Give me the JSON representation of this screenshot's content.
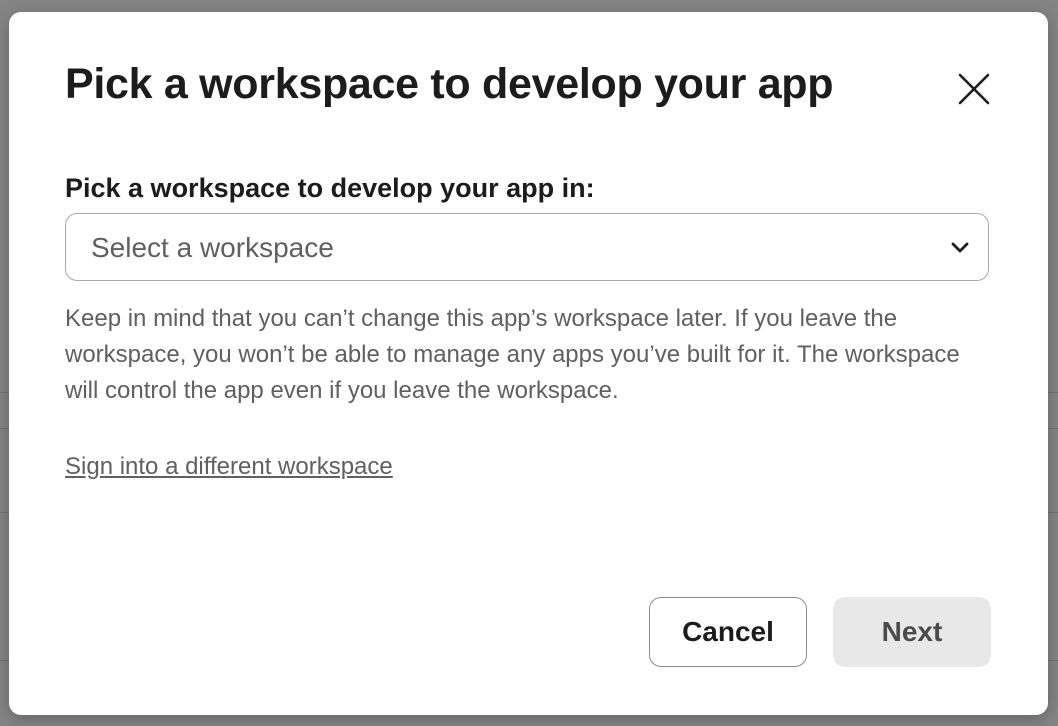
{
  "modal": {
    "title": "Pick a workspace to develop your app",
    "close_icon": "close-icon",
    "field_label": "Pick a workspace to develop your app in:",
    "select": {
      "placeholder": "Select a workspace",
      "icon": "chevron-down-icon"
    },
    "help_text": "Keep in mind that you can’t change this app’s workspace later. If you leave the workspace, you won’t be able to manage any apps you’ve built for it. The workspace will control the app even if you leave the workspace.",
    "signin_link": "Sign into a different workspace",
    "buttons": {
      "cancel": "Cancel",
      "next": "Next"
    }
  },
  "colors": {
    "primary_text": "#1d1c1d",
    "secondary_text": "#616061",
    "disabled_button_bg": "#e8e8e8",
    "overlay": "rgba(0,0,0,0.48)"
  }
}
